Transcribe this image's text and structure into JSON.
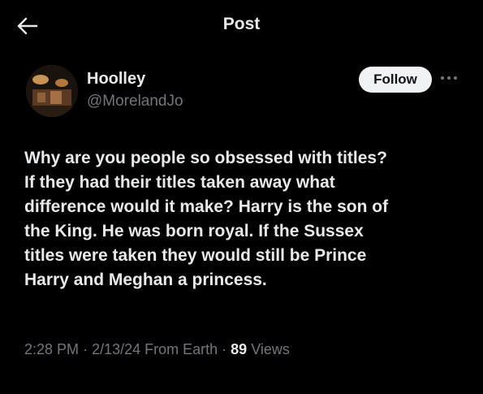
{
  "header": {
    "title": "Post",
    "back_icon": "arrow-left-icon"
  },
  "author": {
    "name": "Hoolley",
    "handle": "@MorelandJo"
  },
  "follow_label": "Follow",
  "more_icon": "more-horizontal-icon",
  "post": {
    "lines": [
      "Why are you people so obsessed with titles?",
      "If they had their titles taken away what",
      "difference would it make? Harry is the son of",
      "the King.  He was born royal.  If the Sussex",
      "titles were taken they would still be Prince",
      "Harry and Meghan a princess."
    ]
  },
  "meta": {
    "time": "2:28 PM",
    "date_location": "2/13/24 From Earth",
    "views_count": "89",
    "views_label": "Views"
  },
  "colors": {
    "background": "#000000",
    "text_primary": "#e7e9ea",
    "text_secondary": "#71767b",
    "follow_bg": "#eff3f4"
  }
}
